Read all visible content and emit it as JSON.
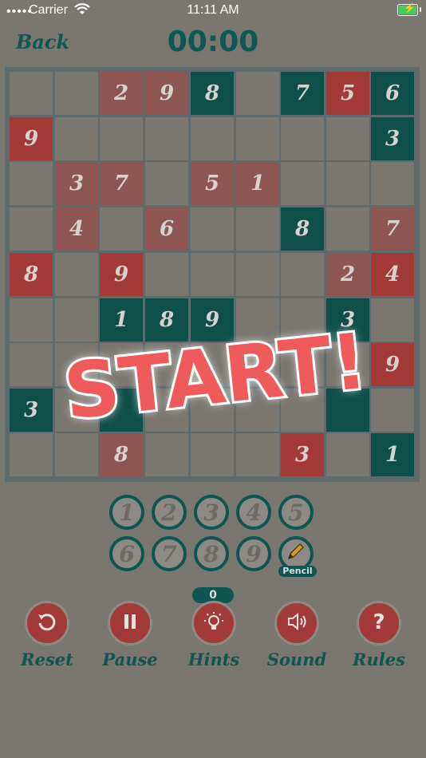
{
  "status_bar": {
    "dots": "•••••",
    "carrier": "Carrier",
    "time": "11:11 AM"
  },
  "header": {
    "back_label": "Back",
    "timer": "00:00"
  },
  "board": {
    "rows": [
      [
        "",
        "",
        "2",
        "9",
        "8",
        "",
        "7",
        "5",
        "6"
      ],
      [
        "9",
        "",
        "",
        "",
        "",
        "",
        "",
        "",
        "3"
      ],
      [
        "",
        "3",
        "7",
        "",
        "5",
        "1",
        "",
        "",
        ""
      ],
      [
        "",
        "4",
        "",
        "6",
        "",
        "",
        "8",
        "",
        "7"
      ],
      [
        "8",
        "",
        "9",
        "",
        "",
        "",
        "",
        "2",
        "4"
      ],
      [
        "",
        "",
        "1",
        "8",
        "9",
        "",
        "",
        "3",
        ""
      ],
      [
        "",
        "",
        "",
        "",
        "",
        "",
        "",
        "",
        "9"
      ],
      [
        "3",
        "",
        "",
        "",
        "",
        "",
        "",
        "",
        ""
      ],
      [
        "",
        "",
        "8",
        "",
        "",
        "",
        "3",
        "",
        "1"
      ]
    ],
    "cell_colors": [
      [
        "",
        "",
        "redf",
        "redf",
        "green",
        "",
        "green",
        "red",
        "green"
      ],
      [
        "red",
        "",
        "",
        "",
        "",
        "",
        "",
        "",
        "green"
      ],
      [
        "",
        "redf",
        "redf",
        "",
        "redf",
        "redf",
        "",
        "",
        ""
      ],
      [
        "",
        "redf",
        "",
        "redf",
        "",
        "",
        "green",
        "",
        "redf"
      ],
      [
        "red",
        "",
        "red",
        "",
        "",
        "",
        "",
        "redf",
        "red"
      ],
      [
        "",
        "",
        "green",
        "green",
        "green",
        "",
        "",
        "green",
        ""
      ],
      [
        "",
        "",
        "",
        "",
        "",
        "",
        "",
        "",
        "red"
      ],
      [
        "green",
        "",
        "green",
        "",
        "",
        "",
        "",
        "green",
        ""
      ],
      [
        "",
        "",
        "redf",
        "",
        "",
        "",
        "red",
        "",
        "green"
      ]
    ],
    "overlay_text": "START!"
  },
  "number_pad": {
    "numbers": [
      "1",
      "2",
      "3",
      "4",
      "5",
      "6",
      "7",
      "8",
      "9"
    ],
    "pencil_label": "Pencil"
  },
  "hints_count": "0",
  "controls": [
    {
      "label": "Reset",
      "icon": "reset-icon"
    },
    {
      "label": "Pause",
      "icon": "pause-icon"
    },
    {
      "label": "Hints",
      "icon": "lightbulb-icon"
    },
    {
      "label": "Sound",
      "icon": "speaker-icon"
    },
    {
      "label": "Rules",
      "icon": "question-icon"
    }
  ],
  "colors": {
    "teal": "#0f5552",
    "red": "#a23a37",
    "background": "#7a7670"
  }
}
